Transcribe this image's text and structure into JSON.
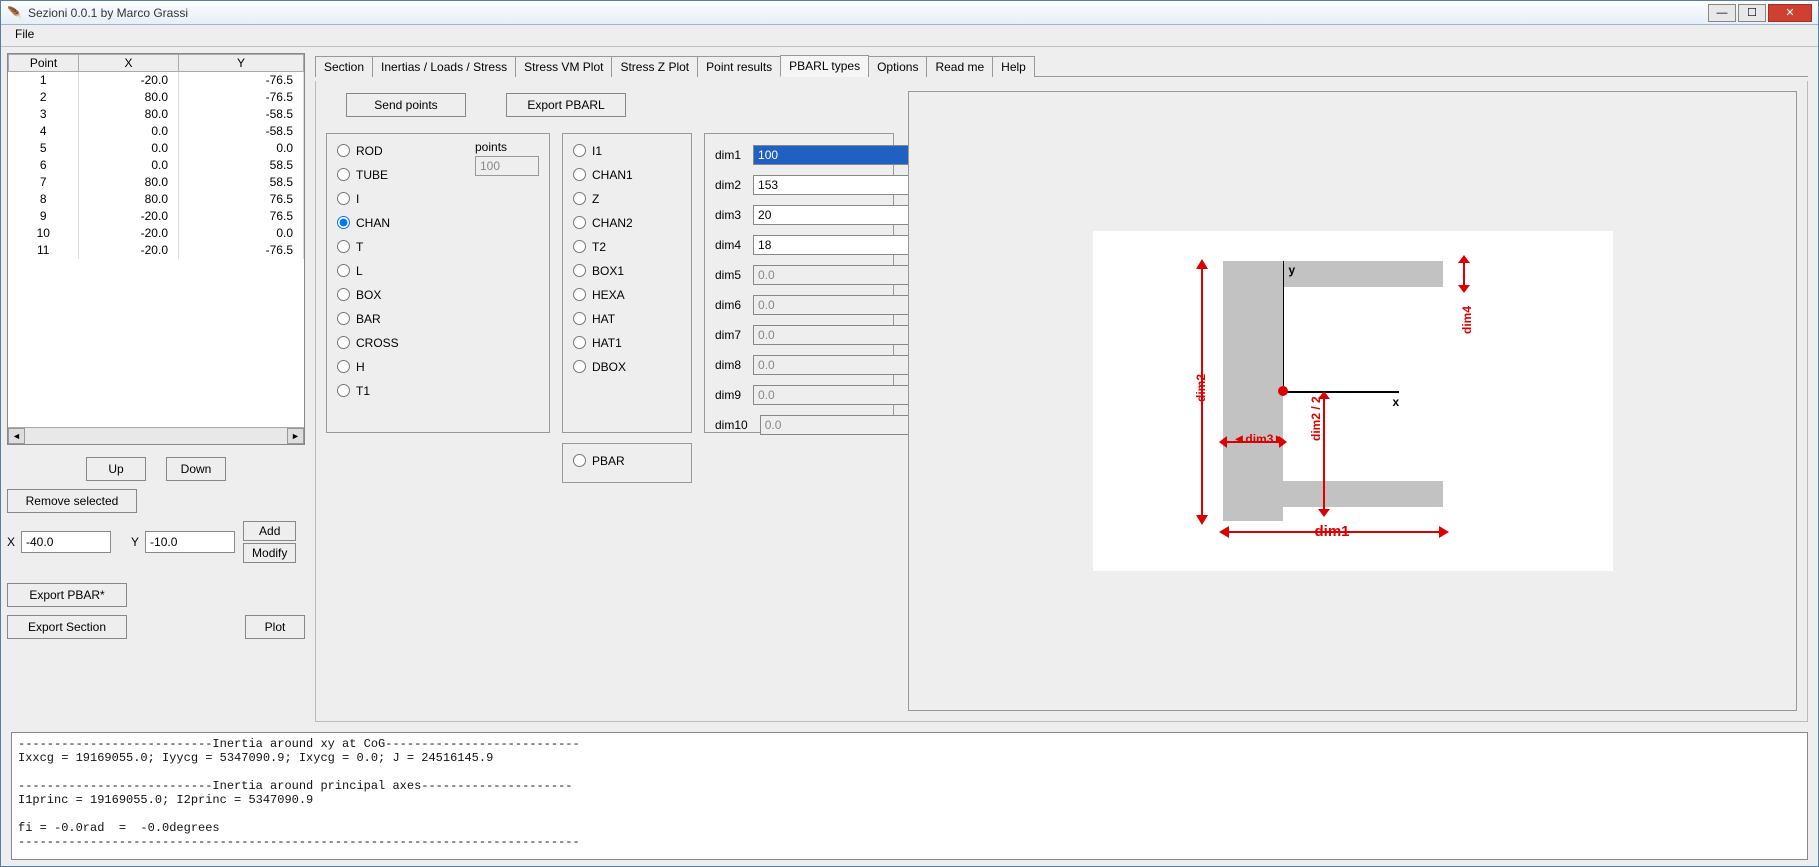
{
  "title": "Sezioni 0.0.1 by Marco Grassi",
  "menu": {
    "file": "File"
  },
  "table": {
    "headers": [
      "Point",
      "X",
      "Y"
    ],
    "rows": [
      {
        "p": "1",
        "x": "-20.0",
        "y": "-76.5"
      },
      {
        "p": "2",
        "x": "80.0",
        "y": "-76.5"
      },
      {
        "p": "3",
        "x": "80.0",
        "y": "-58.5"
      },
      {
        "p": "4",
        "x": "0.0",
        "y": "-58.5"
      },
      {
        "p": "5",
        "x": "0.0",
        "y": "0.0"
      },
      {
        "p": "6",
        "x": "0.0",
        "y": "58.5"
      },
      {
        "p": "7",
        "x": "80.0",
        "y": "58.5"
      },
      {
        "p": "8",
        "x": "80.0",
        "y": "76.5"
      },
      {
        "p": "9",
        "x": "-20.0",
        "y": "76.5"
      },
      {
        "p": "10",
        "x": "-20.0",
        "y": "0.0"
      },
      {
        "p": "11",
        "x": "-20.0",
        "y": "-76.5"
      }
    ]
  },
  "buttons": {
    "up": "Up",
    "down": "Down",
    "remove": "Remove selected",
    "add": "Add",
    "modify": "Modify",
    "exportPbar": "Export PBAR*",
    "exportSection": "Export Section",
    "plot": "Plot",
    "sendPoints": "Send points",
    "exportPbarl": "Export PBARL"
  },
  "xy": {
    "xlabel": "X",
    "xval": "-40.0",
    "ylabel": "Y",
    "yval": "-10.0"
  },
  "tabs": [
    "Section",
    "Inertias / Loads / Stress",
    "Stress VM Plot",
    "Stress Z Plot",
    "Point results",
    "PBARL types",
    "Options",
    "Read me",
    "Help"
  ],
  "activeTab": 5,
  "pbarl": {
    "pointsLabel": "points",
    "pointsVal": "100",
    "groupA": [
      "ROD",
      "TUBE",
      "I",
      "CHAN",
      "T",
      "L",
      "BOX",
      "BAR",
      "CROSS",
      "H",
      "T1"
    ],
    "groupB": [
      "I1",
      "CHAN1",
      "Z",
      "CHAN2",
      "T2",
      "BOX1",
      "HEXA",
      "HAT",
      "HAT1",
      "DBOX"
    ],
    "pbar": "PBAR",
    "selected": "CHAN"
  },
  "dims": {
    "labels": [
      "dim1",
      "dim2",
      "dim3",
      "dim4",
      "dim5",
      "dim6",
      "dim7",
      "dim8",
      "dim9",
      "dim10"
    ],
    "values": [
      "100",
      "153",
      "20",
      "18",
      "0.0",
      "0.0",
      "0.0",
      "0.0",
      "0.0",
      "0.0"
    ],
    "enabled": [
      true,
      true,
      true,
      true,
      false,
      false,
      false,
      false,
      false,
      false
    ],
    "highlighted": 0
  },
  "diagram": {
    "d1": "dim1",
    "d2": "dim2",
    "d3": "dim3",
    "d4": "dim4",
    "d22": "dim2 / 2",
    "x": "x",
    "y": "y"
  },
  "console": "---------------------------Inertia around xy at CoG---------------------------\nIxxcg = 19169055.0; Iyycg = 5347090.9; Ixycg = 0.0; J = 24516145.9\n\n---------------------------Inertia around principal axes---------------------\nI1princ = 19169055.0; I2princ = 5347090.9\n\nfi = -0.0rad  =  -0.0degrees\n------------------------------------------------------------------------------"
}
